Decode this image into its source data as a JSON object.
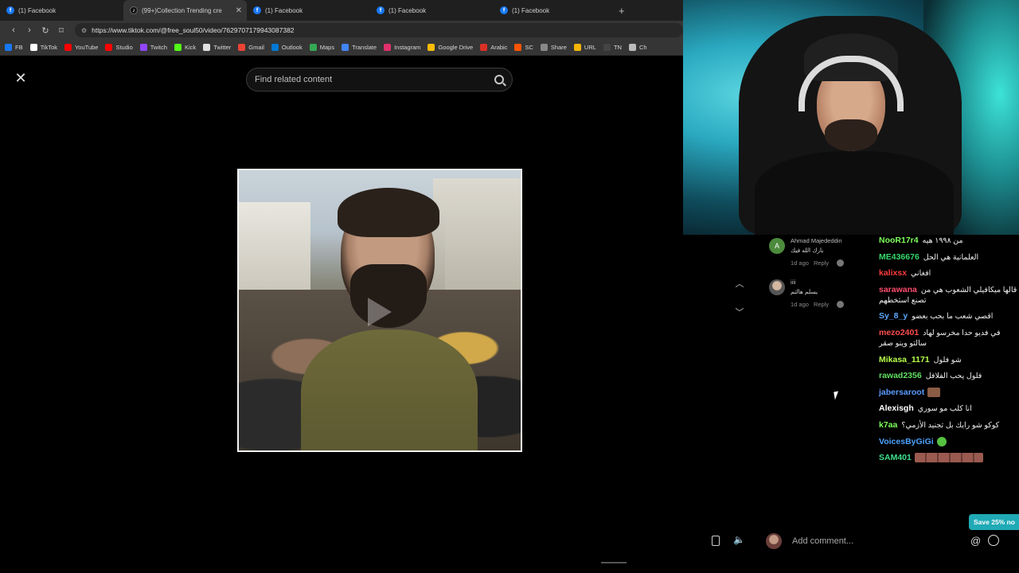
{
  "browser": {
    "tabs": [
      {
        "label": "(1) Facebook",
        "icon": "facebook-icon"
      },
      {
        "label": "(99+)Collection Trending cre",
        "icon": "tiktok-icon",
        "active": true
      },
      {
        "label": "(1) Facebook",
        "icon": "facebook-icon"
      },
      {
        "label": "(1) Facebook",
        "icon": "facebook-icon"
      },
      {
        "label": "(1) Facebook",
        "icon": "facebook-icon"
      }
    ],
    "url": "https://www.tiktok.com/@free_soul50/video/7629707179943087382",
    "bookmarks": [
      {
        "label": "FB",
        "color": "#1877f2"
      },
      {
        "label": "TikTok",
        "color": "#ffffff"
      },
      {
        "label": "YouTube",
        "color": "#ff0000"
      },
      {
        "label": "Studio",
        "color": "#ff0000"
      },
      {
        "label": "Twitch",
        "color": "#9146ff"
      },
      {
        "label": "Kick",
        "color": "#53fc18"
      },
      {
        "label": "Twitter",
        "color": "#e0e0e0"
      },
      {
        "label": "Gmail",
        "color": "#ea4335"
      },
      {
        "label": "Outlook",
        "color": "#0078d4"
      },
      {
        "label": "Maps",
        "color": "#34a853"
      },
      {
        "label": "Translate",
        "color": "#4285f4"
      },
      {
        "label": "Instagram",
        "color": "#e1306c"
      },
      {
        "label": "Google Drive",
        "color": "#fbbc04"
      },
      {
        "label": "Arabic",
        "color": "#d93025"
      },
      {
        "label": "SC",
        "color": "#ff5500"
      },
      {
        "label": "Share",
        "color": "#888888"
      },
      {
        "label": "URL",
        "color": "#f4b400"
      },
      {
        "label": "TN",
        "color": "#444444"
      },
      {
        "label": "Ch",
        "color": "#bbbbbb"
      }
    ]
  },
  "viewer": {
    "search_placeholder": "Find related content"
  },
  "tiktok_comments": [
    {
      "avatar": "A",
      "name": "Ahmad Majededdin",
      "text": "بارك الله فيك",
      "time": "1d ago",
      "reply": "Reply"
    },
    {
      "avatar": "",
      "name": "iiii",
      "text": "يسلم هالتم",
      "time": "1d ago",
      "reply": "Reply"
    }
  ],
  "chat": [
    {
      "user": "NooR17r4",
      "color": "#7cff5a",
      "text": "من ١٩٩٨ هيه"
    },
    {
      "user": "ME436676",
      "color": "#36d86b",
      "text": "العلمانية هي الحل"
    },
    {
      "user": "kalixsx",
      "color": "#ff3b3b",
      "text": "افغاني"
    },
    {
      "user": "sarawana",
      "color": "#ff4d6d",
      "text": "قالها ميكافيلي الشعوب هي من تصنع استخطهم"
    },
    {
      "user": "Sy_8_y",
      "color": "#5aa9ff",
      "text": "اقصي شعب ما بحب بعضو"
    },
    {
      "user": "mezo2401",
      "color": "#ff4d4d",
      "text": "في فديو حدا مخرسو لهاد سالتو وينو صقر"
    },
    {
      "user": "Mikasa_1171",
      "color": "#b8ff4a",
      "text": "شو فلول"
    },
    {
      "user": "rawad2356",
      "color": "#60e060",
      "text": "فلول يحب الفلافل"
    },
    {
      "user": "jabersaroot",
      "color": "#5a9bff",
      "text": ""
    },
    {
      "user": "Alexisgh",
      "color": "#ffffff",
      "text": "انا كلب مو سوري"
    },
    {
      "user": "k7aa",
      "color": "#7cff5a",
      "text": "كوكو شو رايك بل تجنيد الأزمي؟"
    },
    {
      "user": "VoicesByGiGi",
      "color": "#4da3ff",
      "text": ""
    },
    {
      "user": "SAM401",
      "color": "#3ee08a",
      "text": ""
    }
  ],
  "comment_box": {
    "placeholder": "Add comment..."
  },
  "promo": {
    "label": "Save 25% no"
  }
}
